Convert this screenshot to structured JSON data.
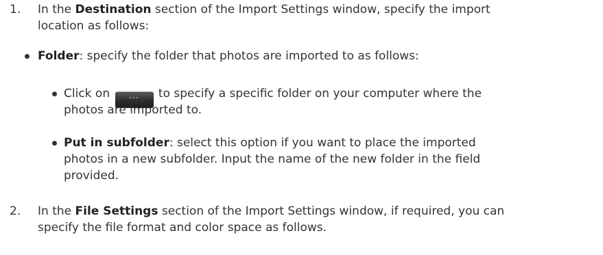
{
  "steps": [
    {
      "number": "1.",
      "lines": [
        {
          "pre": "In the ",
          "bold": "Destination",
          "post": " section of the Import Settings window, specify the import"
        },
        {
          "text": "location as follows:"
        }
      ]
    },
    {
      "number": "2.",
      "lines": [
        {
          "pre": "In the ",
          "bold": "File Settings",
          "post": " section of the Import Settings window, if required, you can"
        },
        {
          "text": "specify the file format and color space as follows."
        }
      ]
    }
  ],
  "folder_item": {
    "bold": "Folder",
    "text": ": specify the folder that photos are imported to as follows:"
  },
  "sub_items": {
    "click": {
      "pre": "Click on ",
      "button_label": "···",
      "post": " to specify a specific folder on your computer where the",
      "line2": "photos are imported to."
    },
    "subfolder": {
      "bold": "Put in subfolder",
      "line1": ": select this option if you want to place the imported",
      "line2": "photos in a new subfolder. Input the name of the new folder in the field",
      "line3": "provided."
    }
  },
  "colors": {
    "text": "#333333",
    "button_bg": "#2e2e2e"
  },
  "icons": {
    "browse_button": "ellipsis-icon"
  }
}
